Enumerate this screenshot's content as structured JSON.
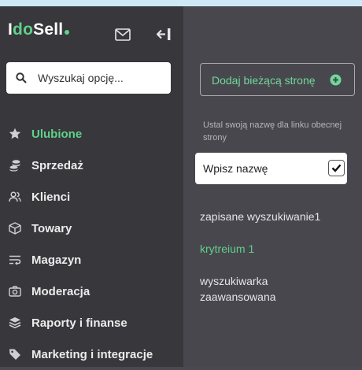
{
  "logo": {
    "prefix": "I",
    "accent": "do",
    "suffix": "Sell"
  },
  "search": {
    "placeholder": "Wyszukaj opcję..."
  },
  "sidebar": {
    "items": [
      {
        "label": "Ulubione",
        "icon": "star-icon",
        "active": true
      },
      {
        "label": "Sprzedaż",
        "icon": "coins-icon"
      },
      {
        "label": "Klienci",
        "icon": "users-icon"
      },
      {
        "label": "Towary",
        "icon": "box-icon"
      },
      {
        "label": "Magazyn",
        "icon": "wrap-text-icon"
      },
      {
        "label": "Moderacja",
        "icon": "camera-icon"
      },
      {
        "label": "Raporty i finanse",
        "icon": "layers-icon"
      },
      {
        "label": "Marketing i integracje",
        "icon": "tag-icon"
      }
    ]
  },
  "panel": {
    "add_button_label": "Dodaj bieżącą stronę",
    "hint": "Ustal swoją nazwę dla linku obecnej strony",
    "name_placeholder": "Wpisz nazwę",
    "saved": [
      {
        "label": "zapisane wyszukiwanie1"
      },
      {
        "label": "krytreium 1",
        "highlight": true
      },
      {
        "label": "wyszukiwarka zaawansowana"
      }
    ]
  },
  "colors": {
    "accent": "#5fd08a",
    "sidebar_bg": "#38373c",
    "panel_bg": "#49474e",
    "top_strip": "#cfe8f5"
  }
}
